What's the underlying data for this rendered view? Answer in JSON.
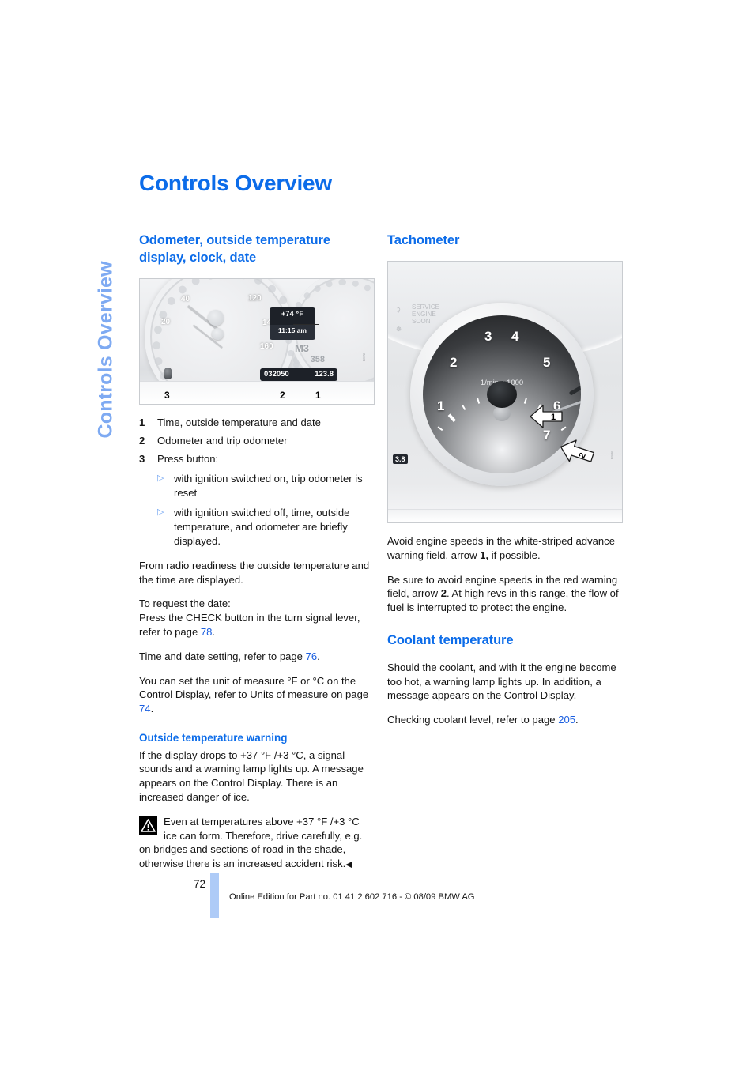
{
  "side_tab": {
    "label": "Controls Overview"
  },
  "page_title": "Controls Overview",
  "left_column": {
    "section_title": "Odometer, outside temperature display, clock, date",
    "figure": {
      "name": "instrument-cluster-figure",
      "lcd_temperature": "+74 °F",
      "lcd_time": "11:15 am",
      "gear": "M3",
      "range": "358",
      "odometer": "032050",
      "trip_odometer": "123.8",
      "speed_labels": [
        "20",
        "40",
        "120",
        "140",
        "160"
      ],
      "callouts": [
        "3",
        "2",
        "1"
      ]
    },
    "numbered_items": [
      {
        "num": "1",
        "text": "Time, outside temperature and date"
      },
      {
        "num": "2",
        "text": "Odometer and trip odometer"
      },
      {
        "num": "3",
        "text": "Press button:"
      }
    ],
    "bullets": [
      "with ignition switched on, trip odometer is reset",
      "with ignition switched off, time, outside temperature, and odometer are briefly displayed."
    ],
    "paragraphs": {
      "radio_readiness": "From radio readiness the outside temperature and the time are displayed.",
      "request_date_lead": "To request the date:",
      "request_date_body_a": "Press the CHECK button in the turn signal lever, refer to page ",
      "request_date_page": "78",
      "request_date_body_b": ".",
      "time_date_setting_a": "Time and date setting, refer to page ",
      "time_date_setting_page": "76",
      "time_date_setting_b": ".",
      "units_a": "You can set the unit of measure °F  or °C on the Control Display, refer to Units of measure on page ",
      "units_page": "74",
      "units_b": "."
    },
    "warning_section": {
      "title": "Outside temperature warning",
      "body": "If the display drops to +37 °F /+3 °C, a signal sounds and a warning lamp lights up. A message appears on the Control Display. There is an increased danger of ice.",
      "notice": "Even at temperatures above +37 °F /+3 °C ice can form. Therefore, drive carefully, e.g. on bridges and sections of road in the shade, otherwise there is an increased accident risk.",
      "end_mark": "◀"
    }
  },
  "right_column": {
    "section_title": "Tachometer",
    "figure": {
      "name": "tachometer-figure",
      "unit_label": "1/min x 1000",
      "scale_numbers": [
        "1",
        "2",
        "3",
        "4",
        "5",
        "6",
        "7"
      ],
      "arrow_labels": [
        "1",
        "2"
      ]
    },
    "paragraphs": {
      "advance_a": "Avoid engine speeds in the white-striped advance warning field, arrow ",
      "advance_bold": "1,",
      "advance_b": " if possible.",
      "red_a": "Be sure to avoid engine speeds in the red warning field, arrow ",
      "red_bold": "2",
      "red_b": ". At high revs in this range, the flow of fuel is interrupted to protect the engine."
    },
    "coolant": {
      "title": "Coolant temperature",
      "body": "Should the coolant, and with it the engine become too hot, a warning lamp lights up. In addition, a message appears on the Control Display.",
      "check_a": "Checking coolant level, refer to page ",
      "check_page": "205",
      "check_b": "."
    }
  },
  "footer": {
    "page_number": "72",
    "credit": "Online Edition for Part no. 01 41 2 602 716 - © 08/09 BMW AG"
  },
  "colors": {
    "heading_blue": "#0c6ce9",
    "sidebar_blue": "#7eaaf2",
    "link_blue": "#1b5fe0",
    "footer_bar_blue": "#aecbf7"
  }
}
